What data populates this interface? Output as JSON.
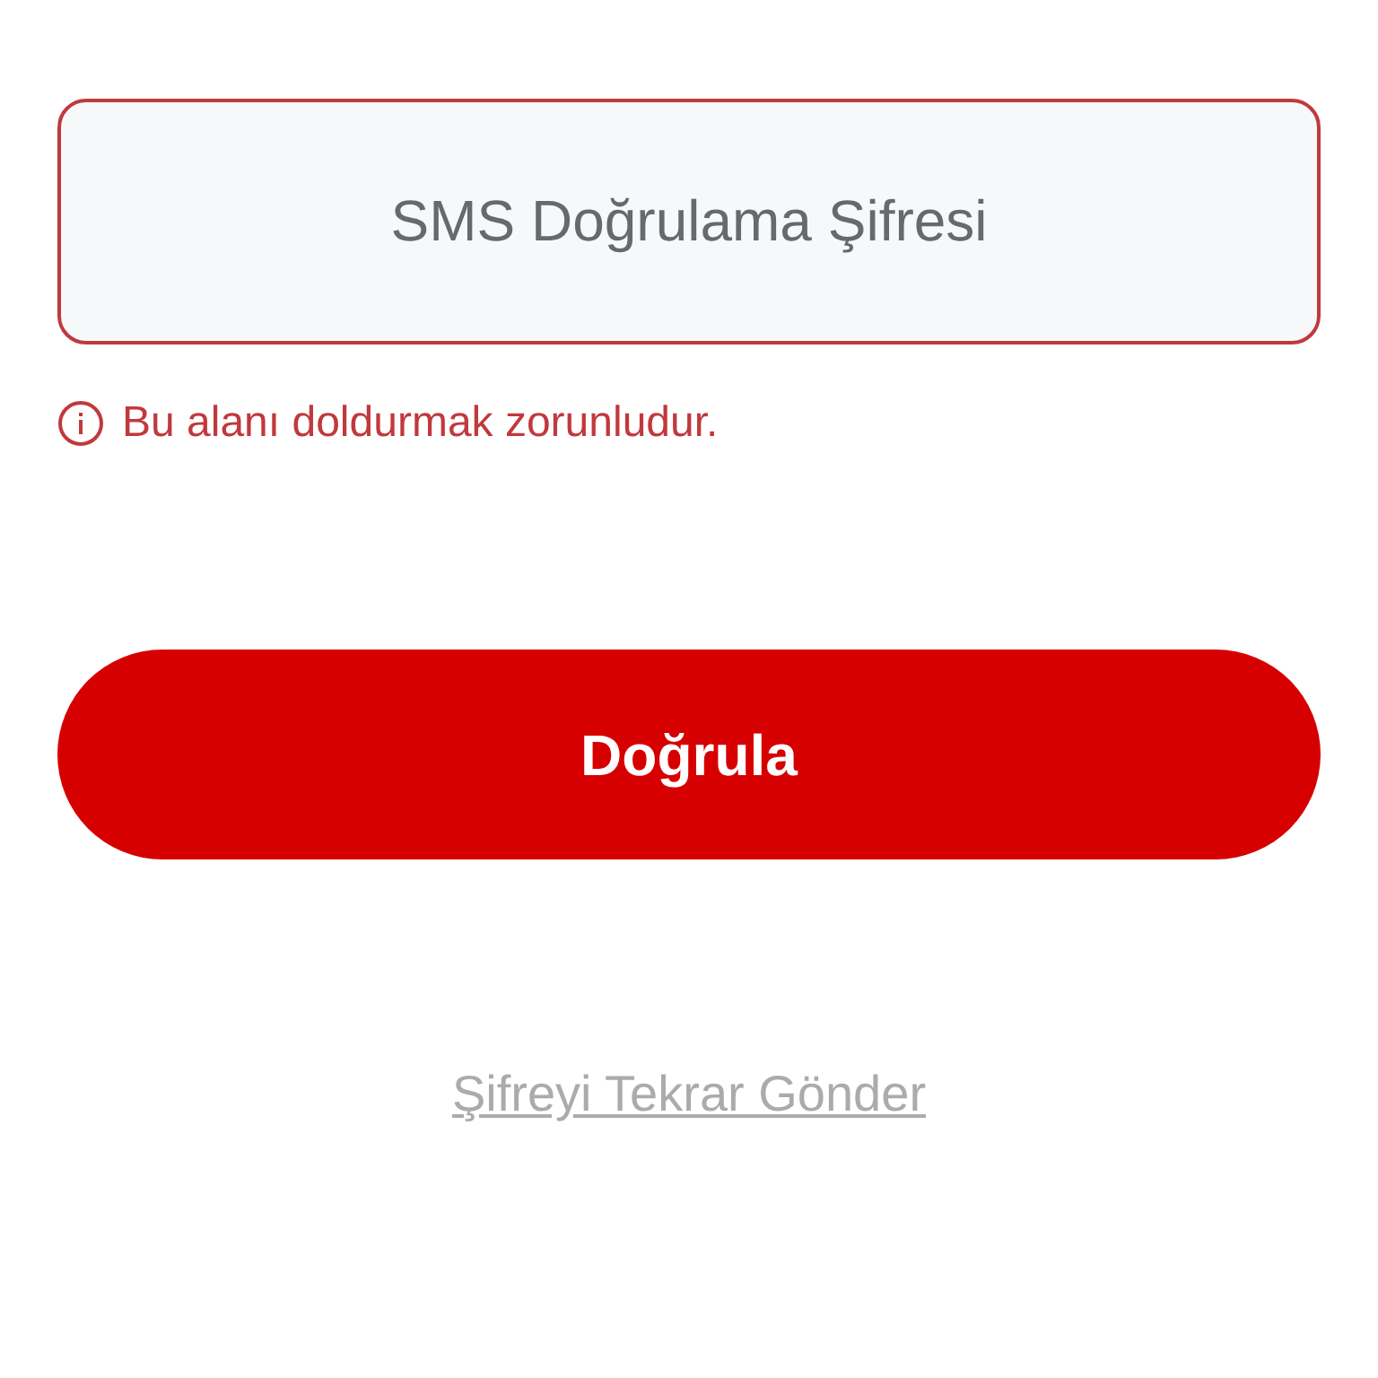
{
  "code_field": {
    "placeholder": "SMS Doğrulama Şifresi",
    "error": true
  },
  "error_message": "Bu alanı doldurmak zorunludur.",
  "verify_button": {
    "label": "Doğrula"
  },
  "resend_link": {
    "label": "Şifreyi Tekrar Gönder"
  }
}
